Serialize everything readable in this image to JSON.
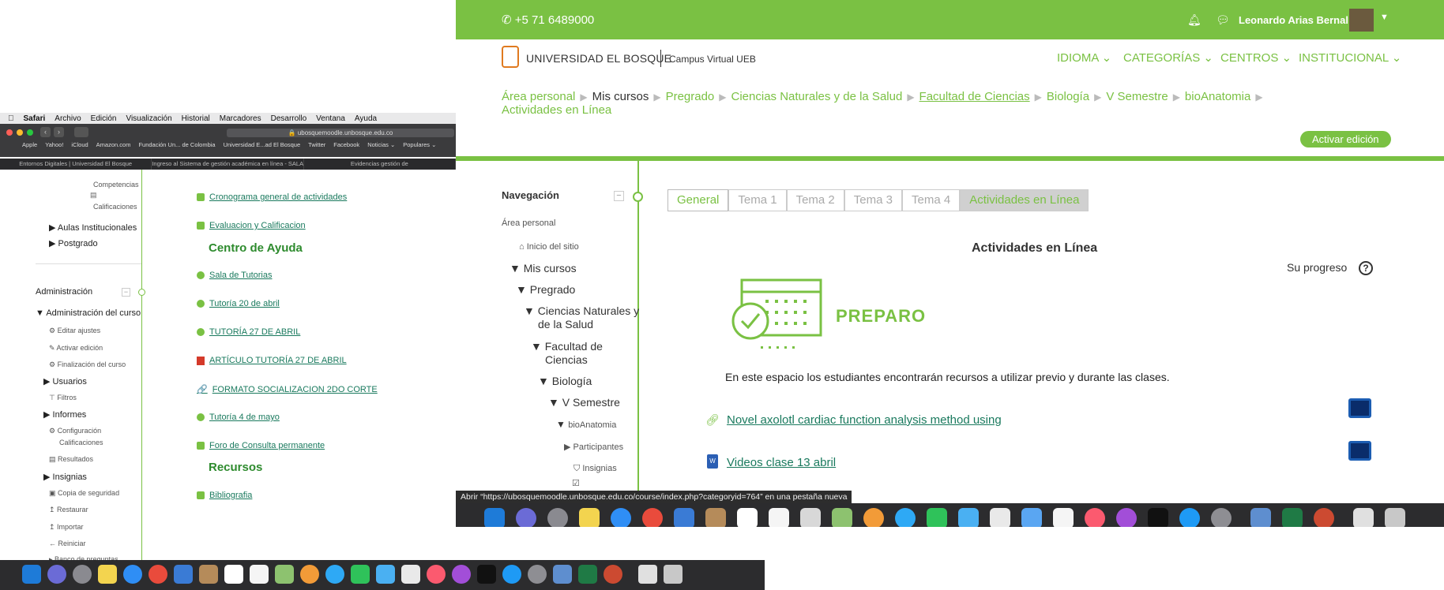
{
  "left": {
    "mac_menu": [
      "Safari",
      "Archivo",
      "Edición",
      "Visualización",
      "Historial",
      "Marcadores",
      "Desarrollo",
      "Ventana",
      "Ayuda"
    ],
    "url": "ubosquemoodle.unbosque.edu.co",
    "favorites": [
      "Apple",
      "Yahoo!",
      "iCloud",
      "Amazon.com",
      "Fundación Un... de Colombia",
      "Universidad E...ad El Bosque",
      "Twitter",
      "Facebook",
      "Noticias ⌄",
      "Populares ⌄"
    ],
    "tabs": [
      "Entornos Digitales | Universidad El Bosque",
      "Ingreso al Sistema de gestión académica en línea - SALA.",
      "Evidencias gestión de"
    ],
    "nav": {
      "competencias": "Competencias",
      "calificaciones": "Calificaciones",
      "aulas": "Aulas Institucionales",
      "postgrado": "Postgrado",
      "administracion": "Administración",
      "admin_curso": "Administración del curso",
      "editar": "Editar ajustes",
      "activar": "Activar edición",
      "finalizacion": "Finalización del curso",
      "usuarios": "Usuarios",
      "filtros": "Filtros",
      "informes": "Informes",
      "config": "Configuración",
      "config2": "Calificaciones",
      "resultados": "Resultados",
      "insignias": "Insignias",
      "copia": "Copia de seguridad",
      "restaurar": "Restaurar",
      "importar": "Importar",
      "reiniciar": "Reiniciar",
      "banco": "Banco de preguntas"
    },
    "activities": {
      "cronograma": "Cronograma general de actividades",
      "evaluacion": "Evaluacion y Calificacion",
      "centro": "Centro de Ayuda",
      "sala": "Sala de Tutorias",
      "tutoria20": "Tutoría 20 de abril",
      "tutoria27": "TUTORÍA 27 DE ABRIL",
      "articulo": "ARTÍCULO TUTORÍA 27 DE ABRIL",
      "formato": "FORMATO SOCIALIZACION 2DO CORTE",
      "tutoria4": "Tutoría 4 de mayo",
      "foro": "Foro de Consulta permanente",
      "recursos": "Recursos",
      "bibliografia": "Bibliografia"
    }
  },
  "right": {
    "phone": "+5 71 6489000",
    "user": "Leonardo Arias Bernal",
    "logo": "UNIVERSIDAD EL BOSQUE",
    "campus": "Campus Virtual UEB",
    "menu": [
      "IDIOMA ⌄",
      "CATEGORÍAS ⌄",
      "CENTROS ⌄",
      "INSTITUCIONAL ⌄"
    ],
    "breadcrumb": [
      "Área personal",
      "Mis cursos",
      "Pregrado",
      "Ciencias Naturales y de la Salud",
      "Facultad de Ciencias",
      "Biología",
      "V Semestre",
      "bioAnatomia"
    ],
    "breadcrumb_last": "Actividades en Línea",
    "activar": "Activar edición",
    "nav": {
      "title": "Navegación",
      "area": "Área personal",
      "inicio": "Inicio del sitio",
      "mis": "Mis cursos",
      "pregrado": "Pregrado",
      "ciencias1": "Ciencias Naturales y",
      "ciencias2": "de la Salud",
      "facultad1": "Facultad de",
      "facultad2": "Ciencias",
      "biologia": "Biología",
      "semestre": "V Semestre",
      "bioanatomia": "bioAnatomia",
      "participantes": "Participantes",
      "insignias": "Insignias"
    },
    "tabs": [
      "General",
      "Tema 1",
      "Tema 2",
      "Tema 3",
      "Tema 4",
      "Actividades en Línea"
    ],
    "section_title": "Actividades en Línea",
    "progreso": "Su progreso",
    "preparo": "PREPARO",
    "description": "En este espacio los estudiantes encontrarán recursos a utilizar previo y durante las clases.",
    "link1": "Novel axolotl cardiac function analysis method using",
    "link2": "Videos clase 13 abril",
    "status": "Abrir “https://ubosquemoodle.unbosque.edu.co/course/index.php?categoryid=764” en una pestaña nueva",
    "accent": "#7ac143"
  }
}
